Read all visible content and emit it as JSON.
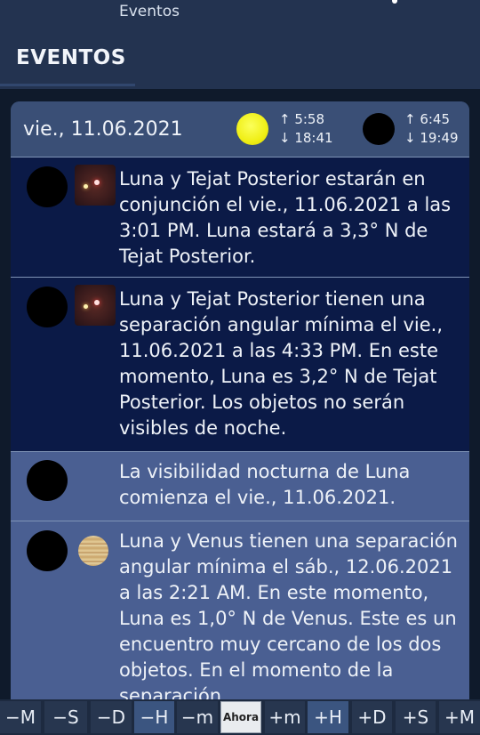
{
  "statusbar": {
    "title": "Eventos"
  },
  "appbar": {
    "heading": "EVENTOS"
  },
  "day": {
    "date": "vie., 11.06.2021",
    "sun": {
      "rise": "↑ 5:58",
      "set": "↓ 18:41"
    },
    "moon": {
      "rise": "↑ 6:45",
      "set": "↓ 19:49"
    }
  },
  "events": [
    {
      "text": "Luna y Tejat Posterior estarán en conjunción el vie., 11.06.2021 a las 3:01 PM. Luna estará a 3,3° N de Tejat Posterior."
    },
    {
      "text": "Luna y Tejat Posterior tienen una separación angular mínima el vie., 11.06.2021 a las 4:33 PM. En este momento, Luna es 3,2° N de Tejat Posterior. Los objetos no serán visibles de noche."
    },
    {
      "text": "La visibilidad nocturna de Luna comienza el vie., 11.06.2021."
    },
    {
      "text": "Luna y Venus tienen una separación angular mínima el sáb., 12.06.2021 a las 2:21 AM. En este momento, Luna es 1,0° N de Venus. Este es un encuentro muy cercano de los dos objetos. En el momento de la separación"
    }
  ],
  "toolbar": {
    "minus_month": "−M",
    "minus_sec": "−S",
    "minus_day": "−D",
    "minus_hour": "−H",
    "minus_min": "−m",
    "now": "Ahora",
    "plus_min": "+m",
    "plus_hour": "+H",
    "plus_day": "+D",
    "plus_sec": "+S",
    "plus_month": "+M"
  }
}
